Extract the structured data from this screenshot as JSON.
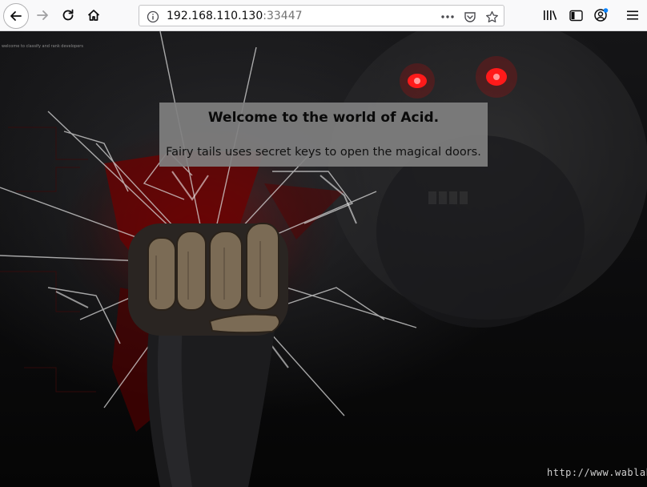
{
  "browser": {
    "url_host": "192.168.110.130",
    "url_port": ":33447",
    "icons": {
      "back": "back-arrow-icon",
      "forward": "forward-arrow-icon",
      "reload": "reload-icon",
      "home": "home-icon",
      "site_info": "info-icon",
      "page_actions": "more-dots-icon",
      "pocket": "pocket-icon",
      "bookmark": "star-icon",
      "library": "library-icon",
      "sidebar": "sidebar-icon",
      "account": "account-icon",
      "menu": "hamburger-menu-icon"
    }
  },
  "page": {
    "tiny_text": "welcome to classify and rank developers",
    "heading": "Welcome to the world of Acid.",
    "subtitle": "Fairy tails uses secret keys to open the magical doors.",
    "watermark": "http://www.wablab"
  },
  "colors": {
    "eyes": "#ff1010",
    "accent_red": "#8b0000"
  }
}
